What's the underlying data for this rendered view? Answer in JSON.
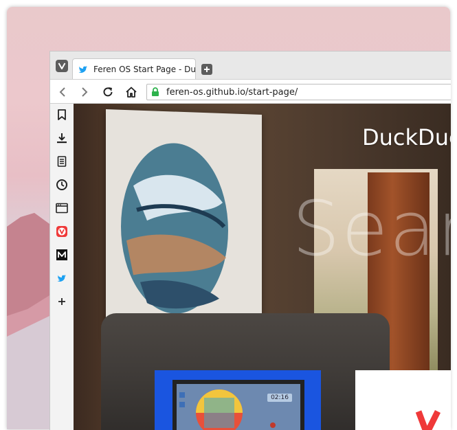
{
  "browser": {
    "tab": {
      "title": "Feren OS Start Page - DuckDuckGo"
    },
    "address": {
      "url": "feren-os.github.io/start-page/"
    }
  },
  "page": {
    "brand_text": "DuckDuckGo",
    "hero_text": "Search",
    "laptop_clock": "02:16"
  },
  "colors": {
    "desktop_pink": "#e9c9cb",
    "vivaldi_red": "#ef3939",
    "twitter_blue": "#1da1f2",
    "lock_green": "#2db24c",
    "card_blue": "#1a55e0"
  }
}
